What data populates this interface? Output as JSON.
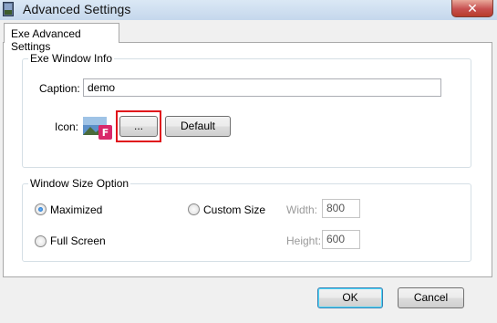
{
  "window": {
    "title": "Advanced Settings",
    "close_glyph": "✕"
  },
  "tab": {
    "label": "Exe Advanced Settings"
  },
  "exe_window_info": {
    "group_label": "Exe Window Info",
    "caption_label": "Caption:",
    "caption_value": "demo",
    "icon_label": "Icon:",
    "browse_button": "...",
    "default_button": "Default"
  },
  "window_size_option": {
    "group_label": "Window Size Option",
    "maximized": {
      "label": "Maximized",
      "checked": true
    },
    "custom_size": {
      "label": "Custom Size",
      "checked": false
    },
    "full_screen": {
      "label": "Full Screen",
      "checked": false
    },
    "width_label": "Width:",
    "width_value": "800",
    "height_label": "Height:",
    "height_value": "600"
  },
  "footer": {
    "ok_button": "OK",
    "cancel_button": "Cancel"
  },
  "colors": {
    "highlight_border": "#e0101a",
    "title_bar": "#c5d7ec",
    "close_button": "#c75050"
  },
  "icons": [
    "app-icon",
    "close-icon",
    "exe-icon-preview"
  ]
}
